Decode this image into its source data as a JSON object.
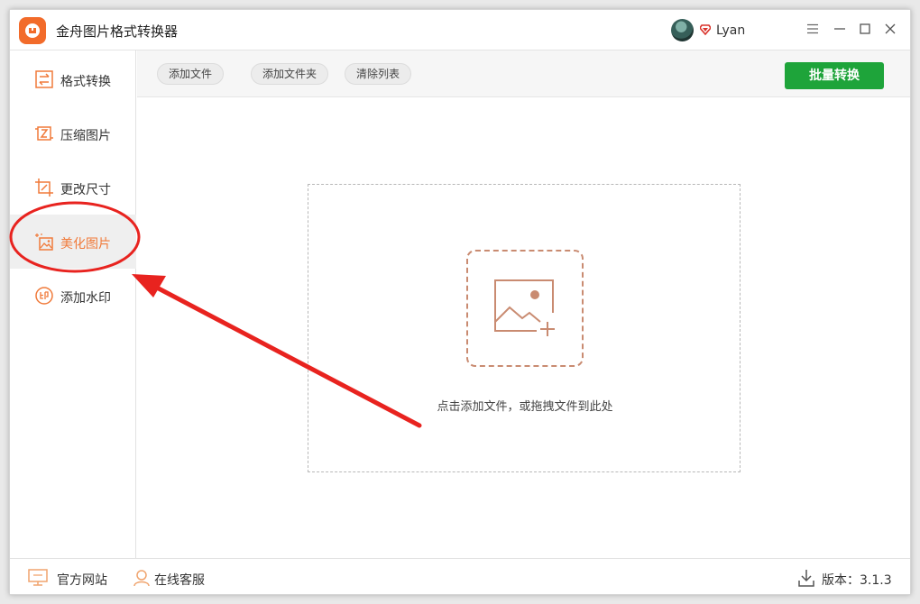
{
  "app": {
    "title": "金舟图片格式转换器"
  },
  "user": {
    "name": "Lyan",
    "vip_icon": "vip-diamond-icon"
  },
  "window_controls": [
    "menu-icon",
    "minimize-icon",
    "maximize-icon",
    "close-icon"
  ],
  "sidebar": {
    "items": [
      {
        "label": "格式转换",
        "icon": "convert-icon"
      },
      {
        "label": "压缩图片",
        "icon": "compress-icon"
      },
      {
        "label": "更改尺寸",
        "icon": "resize-icon"
      },
      {
        "label": "美化图片",
        "icon": "beautify-icon",
        "active": true
      },
      {
        "label": "添加水印",
        "icon": "watermark-icon"
      }
    ]
  },
  "toolbar": {
    "add_file": "添加文件",
    "add_folder": "添加文件夹",
    "clear_list": "清除列表",
    "batch_convert": "批量转换"
  },
  "dropzone": {
    "hint": "点击添加文件，或拖拽文件到此处"
  },
  "footer": {
    "website": "官方网站",
    "support": "在线客服",
    "version": "版本：3.1.3"
  },
  "colors": {
    "accent": "#f07a3a",
    "primary_button": "#1ea43a",
    "annotation": "#e8231f"
  }
}
